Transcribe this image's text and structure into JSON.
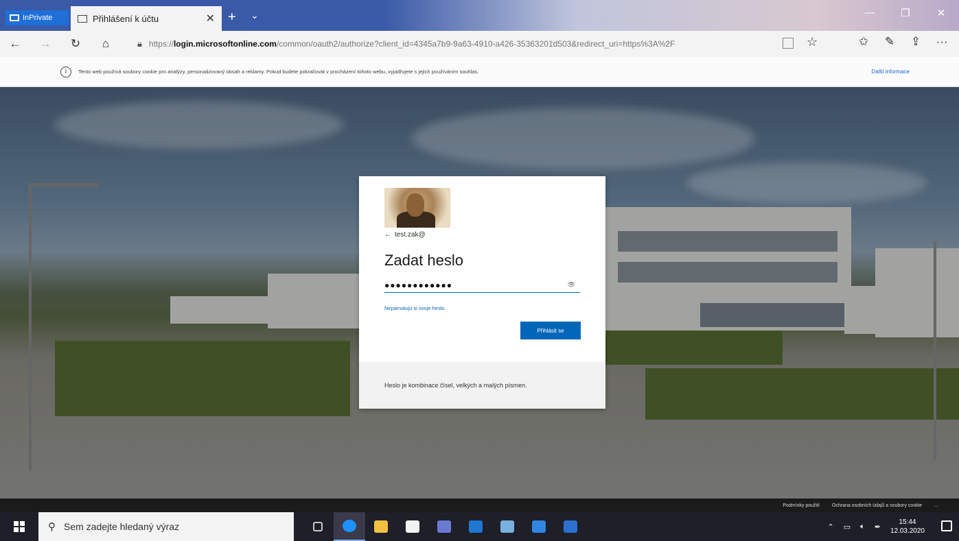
{
  "browser": {
    "inprivate_label": "InPrivate",
    "tab_title": "Přihlášení k účtu",
    "tab_close": "✕",
    "new_tab": "+",
    "tab_menu": "⌄",
    "window_controls": {
      "minimize": "—",
      "maximize": "❐",
      "close": "✕"
    },
    "nav": {
      "back": "←",
      "forward": "→",
      "refresh": "↻",
      "home": "⌂"
    },
    "url_prefix": "https://",
    "url_domain": "login.microsoftonline.com",
    "url_rest": "/common/oauth2/authorize?client_id=4345a7b9-9a63-4910-a426-35363201d503&redirect_uri=https%3A%2F",
    "toolbar_icons": {
      "favorites": "✩",
      "hub": "☆",
      "ink": "✎",
      "share": "⇪",
      "more": "···"
    }
  },
  "cookie_banner": {
    "text": "Tento web používá soubory cookie pro analýzy, personalizovaný obsah a reklamy. Pokud budete pokračovat v procházení tohoto webu, vyjadřujete s jejich používáním souhlas.",
    "more_link": "Další informace"
  },
  "login_card": {
    "account": "test.zak@",
    "title": "Zadat heslo",
    "password_mask": "●●●●●●●●●●●●",
    "forgot_link": "Nepamatuju si svoje heslo",
    "signin_button": "Přihlásit se",
    "footer_text": "Heslo je kombinace čísel, velkých a malých písmen."
  },
  "page_footer": {
    "terms": "Podmínky použití",
    "privacy": "Ochrana osobních údajů a soubory cookie",
    "more": "..."
  },
  "taskbar": {
    "search_placeholder": "Sem zadejte hledaný výraz",
    "time": "15:44",
    "date": "12.03.2020",
    "icon_colors": [
      "#c7c7c7",
      "#1e90ff",
      "#f0c040",
      "#f3f3f3",
      "#6a7ad0",
      "#1f77d0",
      "#7ab0e0",
      "#2f86e0",
      "#2b6fd0"
    ]
  }
}
